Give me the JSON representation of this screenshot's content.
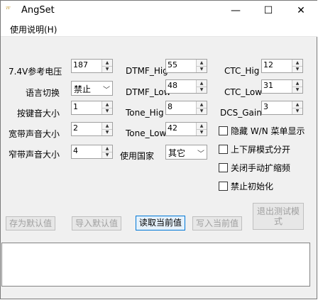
{
  "window": {
    "icon_text": "ᵀᵀ",
    "title": "AngSet",
    "minimize_glyph": "—",
    "maximize_glyph": "☐",
    "close_glyph": "✕"
  },
  "menu": {
    "items": [
      "使用说明(H)"
    ]
  },
  "col1": [
    {
      "label": "7.4V参考电压",
      "value": "187"
    },
    {
      "label": "语言切换",
      "value": "禁止"
    },
    {
      "label": "按键音大小",
      "value": "1"
    },
    {
      "label": "宽带声音大小",
      "value": "2"
    },
    {
      "label": "窄带声音大小",
      "value": "4"
    }
  ],
  "col2": [
    {
      "label": "DTMF_Hig",
      "value": "55"
    },
    {
      "label": "DTMF_Low",
      "value": "48"
    },
    {
      "label": "Tone_Hig",
      "value": "8"
    },
    {
      "label": "Tone_Low",
      "value": "42"
    },
    {
      "label": "使用国家",
      "value": "其它"
    }
  ],
  "col3": [
    {
      "label": "CTC_Hig",
      "value": "12"
    },
    {
      "label": "CTC_Low",
      "value": "31"
    },
    {
      "label": "DCS_Gain",
      "value": "3"
    }
  ],
  "checkboxes": [
    "隐藏 W/N 菜单显示",
    "上下屏模式分开",
    "关闭手动扩缩频",
    "禁止初始化"
  ],
  "buttons": {
    "save_default": "存为默认值",
    "import_default": "导入默认值",
    "read_current": "读取当前值",
    "write_current": "写入当前值",
    "exit_test_line1": "退出测试模",
    "exit_test_line2": "式"
  },
  "output_text": ""
}
